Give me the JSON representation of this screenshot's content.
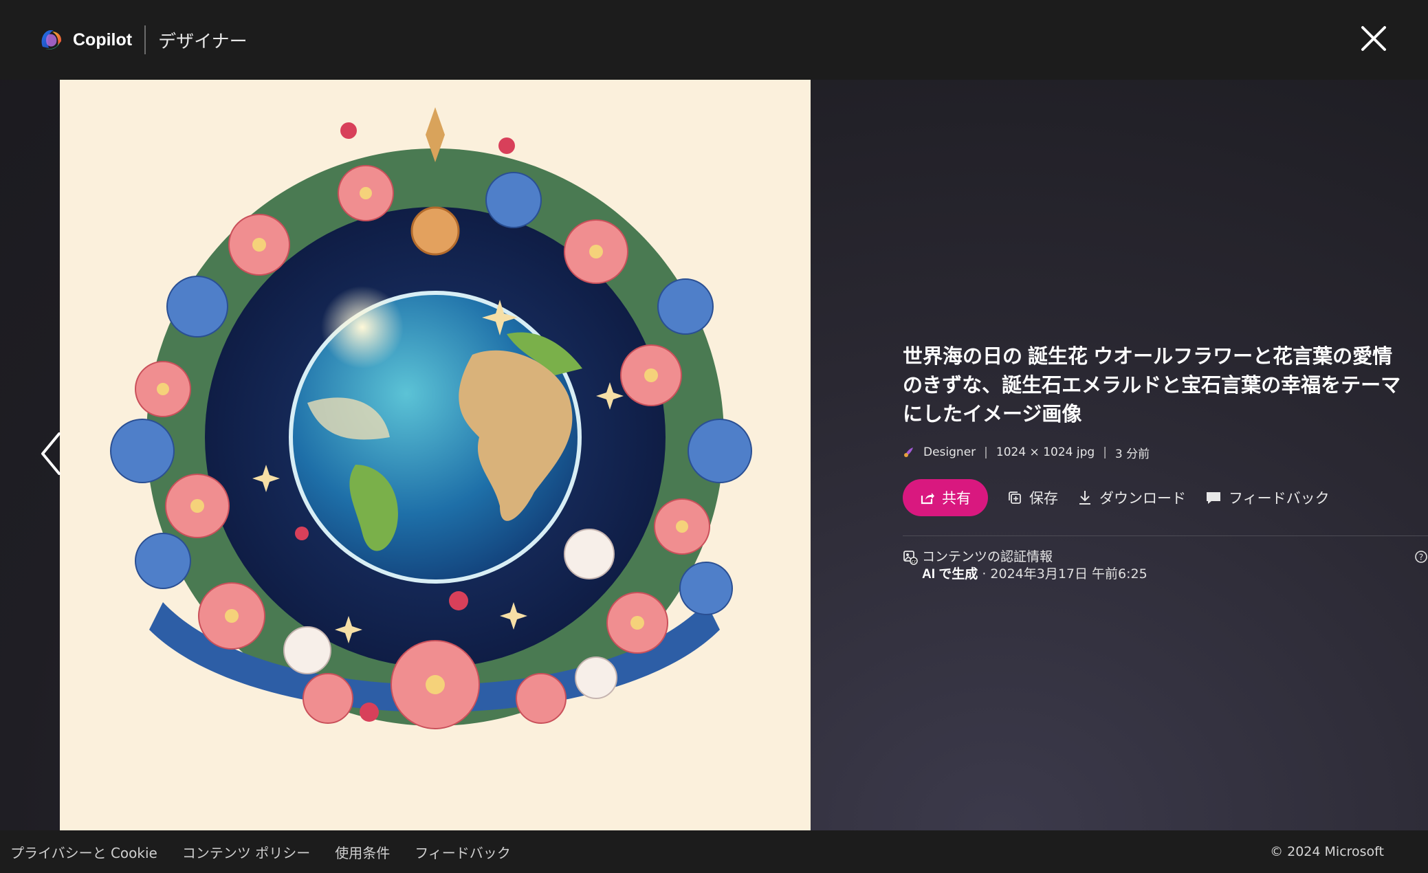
{
  "header": {
    "brand": "Copilot",
    "subtitle": "デザイナー",
    "icons": {
      "logo": "copilot-logo",
      "close": "close-icon"
    }
  },
  "image": {
    "description_icon": "generated-image"
  },
  "info": {
    "title": "世界海の日の 誕生花 ウオールフラワーと花言葉の愛情のきずな、誕生石エメラルドと宝石言葉の幸福をテーマにしたイメージ画像",
    "meta": {
      "creator": "Designer",
      "dimensions": "1024 × 1024 jpg",
      "age": "3 分前",
      "separator": "|"
    },
    "actions": {
      "share": "共有",
      "save": "保存",
      "download": "ダウンロード",
      "feedback": "フィードバック"
    },
    "credentials": {
      "title": "コンテンツの認証情報",
      "generated_label": "AI で生成",
      "date": " · 2024年3月17日 午前6:25"
    }
  },
  "footer": {
    "links": [
      "プライバシーと Cookie",
      "コンテンツ ポリシー",
      "使用条件",
      "フィードバック"
    ],
    "copyright": "© 2024 Microsoft"
  },
  "colors": {
    "accent": "#d9187f",
    "header_bg": "#1c1c1c",
    "image_bg": "#fbf0dc"
  }
}
